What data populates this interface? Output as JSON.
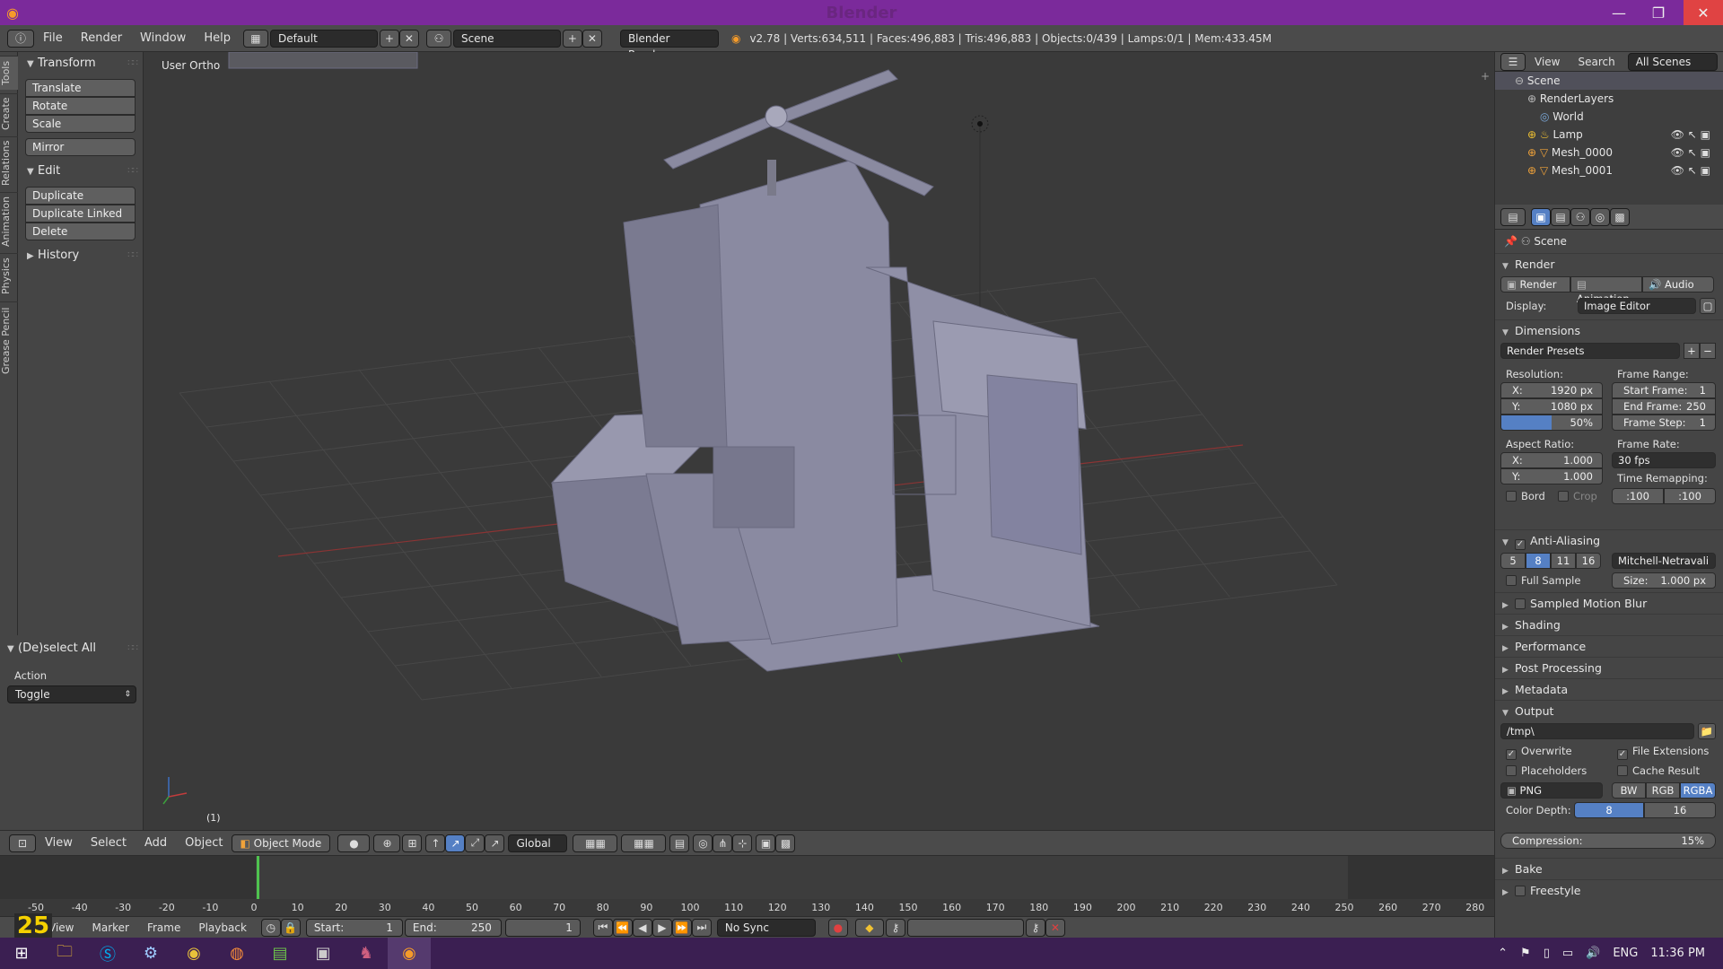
{
  "window": {
    "title": "Blender",
    "minimize": "—",
    "maximize": "❐",
    "close": "✕"
  },
  "menu": {
    "items": [
      "File",
      "Render",
      "Window",
      "Help"
    ],
    "layout": "Default",
    "scene": "Scene",
    "engine": "Blender Render",
    "stats": "v2.78 | Verts:634,511 | Faces:496,883 | Tris:496,883 | Objects:0/439 | Lamps:0/1 | Mem:433.45M"
  },
  "lefttabs": [
    "Tools",
    "Create",
    "Relations",
    "Animation",
    "Physics",
    "Grease Pencil"
  ],
  "toolshelf": {
    "transform": {
      "title": "Transform",
      "buttons": [
        "Translate",
        "Rotate",
        "Scale"
      ],
      "mirror": "Mirror"
    },
    "edit": {
      "title": "Edit",
      "buttons": [
        "Duplicate",
        "Duplicate Linked",
        "Delete"
      ]
    },
    "history": {
      "title": "History"
    }
  },
  "operator": {
    "title": "(De)select All",
    "action_label": "Action",
    "action_value": "Toggle"
  },
  "viewport": {
    "label": "User Ortho",
    "frame": "(1)"
  },
  "header3d": {
    "view": "View",
    "select": "Select",
    "add": "Add",
    "object": "Object",
    "mode": "Object Mode",
    "orientation": "Global"
  },
  "timeline": {
    "ticks": [
      "-50",
      "-40",
      "-30",
      "-20",
      "-10",
      "0",
      "10",
      "20",
      "30",
      "40",
      "50",
      "60",
      "70",
      "80",
      "90",
      "100",
      "110",
      "120",
      "130",
      "140",
      "150",
      "160",
      "170",
      "180",
      "190",
      "200",
      "210",
      "220",
      "230",
      "240",
      "250",
      "260",
      "270",
      "280"
    ],
    "current_frame_badge": "25"
  },
  "tl_footer": {
    "view": "View",
    "marker": "Marker",
    "frame": "Frame",
    "playback": "Playback",
    "start_label": "Start:",
    "start": "1",
    "end_label": "End:",
    "end": "250",
    "current": "1",
    "sync": "No Sync"
  },
  "outliner": {
    "view": "View",
    "search": "Search",
    "filter": "All Scenes",
    "rows": [
      "Scene",
      "RenderLayers",
      "World",
      "Lamp",
      "Mesh_0000",
      "Mesh_0001"
    ]
  },
  "props": {
    "context": "Scene",
    "render": {
      "title": "Render",
      "render_btn": "Render",
      "animation_btn": "Animation",
      "audio_btn": "Audio",
      "display_label": "Display:",
      "display": "Image Editor"
    },
    "dimensions": {
      "title": "Dimensions",
      "presets": "Render Presets",
      "res_label": "Resolution:",
      "x": "X:",
      "x_val": "1920 px",
      "y": "Y:",
      "y_val": "1080 px",
      "pct": "50%",
      "range_label": "Frame Range:",
      "start": "Start Frame:",
      "start_val": "1",
      "end": "End Frame:",
      "end_val": "250",
      "step": "Frame Step:",
      "step_val": "1",
      "aspect_label": "Aspect Ratio:",
      "ax_val": "1.000",
      "ay_val": "1.000",
      "rate_label": "Frame Rate:",
      "rate": "30 fps",
      "remap_label": "Time Remapping:",
      "remap_old": ":100",
      "remap_new": ":100",
      "bord": "Bord",
      "crop": "Crop"
    },
    "aa": {
      "title": "Anti-Aliasing",
      "samples": [
        "5",
        "8",
        "11",
        "16"
      ],
      "filter": "Mitchell-Netravali",
      "full_sample": "Full Sample",
      "size": "Size:",
      "size_val": "1.000 px"
    },
    "collapsed": [
      "Sampled Motion Blur",
      "Shading",
      "Performance",
      "Post Processing",
      "Metadata"
    ],
    "output": {
      "title": "Output",
      "path": "/tmp\\",
      "overwrite": "Overwrite",
      "file_ext": "File Extensions",
      "placeholders": "Placeholders",
      "cache": "Cache Result",
      "format": "PNG",
      "bw": "BW",
      "rgb": "RGB",
      "rgba": "RGBA",
      "depth_label": "Color Depth:",
      "depth8": "8",
      "depth16": "16",
      "compression": "Compression:",
      "compression_val": "15%"
    },
    "bake": "Bake",
    "freestyle": "Freestyle"
  },
  "taskbar": {
    "lang": "ENG",
    "time": "11:36 PM"
  }
}
